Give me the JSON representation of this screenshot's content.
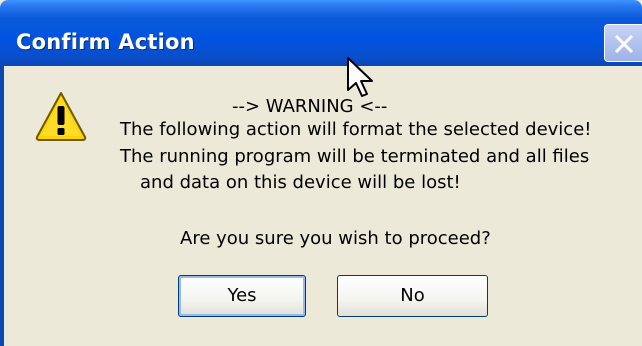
{
  "dialog": {
    "title": "Confirm Action",
    "close_icon": "close-icon",
    "warning_icon": "warning-icon",
    "lines": [
      "--> WARNING  <--",
      "The following action will format the selected device!",
      "The running program will be terminated and all files",
      "and data on this device will be lost!"
    ],
    "question": "Are you sure you wish to proceed?",
    "buttons": {
      "yes": "Yes",
      "no": "No"
    }
  },
  "colors": {
    "titlebar": "#0053e1",
    "dialog_background": "#ece9d8",
    "warning_yellow": "#ffd400",
    "button_border": "#003c74"
  }
}
